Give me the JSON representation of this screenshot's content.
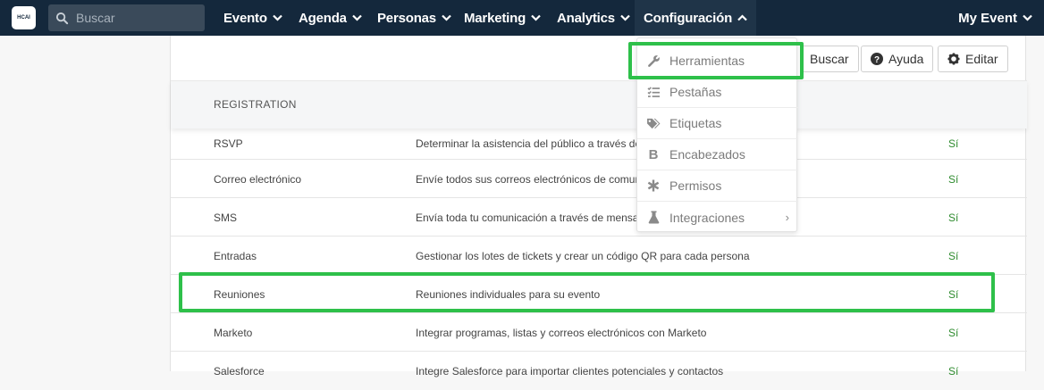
{
  "nav": {
    "logo_text": "HCAI",
    "search_placeholder": "Buscar",
    "items": [
      "Evento",
      "Agenda",
      "Personas",
      "Marketing",
      "Analytics",
      "Configuración"
    ],
    "right": "My Event"
  },
  "toolbar": {
    "search_label": "Buscar",
    "help_label": "Ayuda",
    "edit_label": "Editar"
  },
  "table": {
    "section_header": "REGISTRATION",
    "rows": [
      {
        "name": "RSVP",
        "desc": "Determinar la asistencia del público a través de",
        "status": "Sí"
      },
      {
        "name": "Correo electrónico",
        "desc": "Envíe todos sus correos electrónicos de comun",
        "status": "Sí"
      },
      {
        "name": "SMS",
        "desc": "Envía toda tu comunicación a través de mensaje",
        "status": "Sí"
      },
      {
        "name": "Entradas",
        "desc": "Gestionar los lotes de tickets y crear un código QR para cada persona",
        "status": "Sí"
      },
      {
        "name": "Reuniones",
        "desc": "Reuniones individuales para su evento",
        "status": "Sí"
      },
      {
        "name": "Marketo",
        "desc": "Integrar programas, listas y correos electrónicos con Marketo",
        "status": "Sí"
      },
      {
        "name": "Salesforce",
        "desc": "Integre Salesforce para importar clientes potenciales y contactos",
        "status": "Sí"
      }
    ]
  },
  "dropdown": {
    "items": [
      {
        "label": "Herramientas",
        "icon": "wrench-icon"
      },
      {
        "label": "Pestañas",
        "icon": "list-check-icon"
      },
      {
        "label": "Etiquetas",
        "icon": "tags-icon"
      },
      {
        "label": "Encabezados",
        "icon": "bold-icon"
      },
      {
        "label": "Permisos",
        "icon": "asterisk-icon"
      },
      {
        "label": "Integraciones",
        "icon": "flask-icon"
      }
    ]
  },
  "colors": {
    "nav_bg": "#14283c",
    "highlight": "#2ec04a",
    "status_green": "#2e8b2e"
  }
}
